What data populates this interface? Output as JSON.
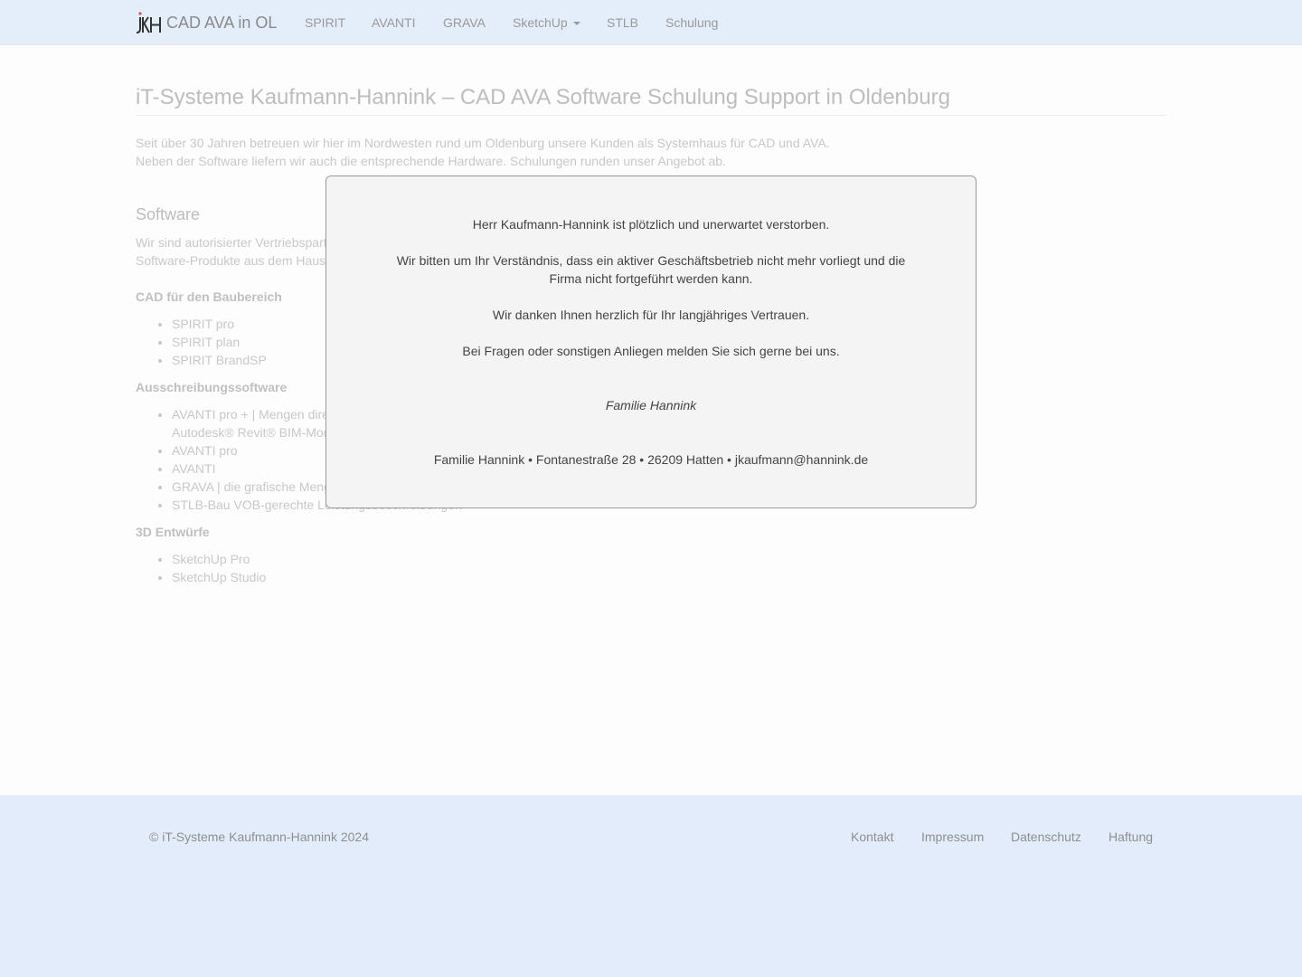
{
  "navbar": {
    "brand_text": "CAD AVA in OL",
    "items": [
      {
        "label": "SPIRIT"
      },
      {
        "label": "AVANTI"
      },
      {
        "label": "GRAVA"
      },
      {
        "label": "SketchUp"
      },
      {
        "label": "STLB"
      },
      {
        "label": "Schulung"
      }
    ]
  },
  "main": {
    "title": "iT-Systeme Kaufmann-Hannink – CAD AVA Software Schulung Support in Oldenburg",
    "intro_line1": "Seit über 30 Jahren betreuen wir hier im Nordwesten rund um Oldenburg unsere Kunden als Systemhaus für CAD und AVA.",
    "intro_line2": "Neben der Software liefern wir auch die entsprechende Hardware. Schulungen runden unser Angebot ab.",
    "software_heading": "Software",
    "software_line1": "Wir sind autorisierter Vertriebspartner",
    "software_line2": "Software-Produkte aus dem Haus",
    "categories": [
      {
        "title": "CAD für den Baubereich",
        "items": [
          "SPIRIT pro",
          "SPIRIT plan",
          "SPIRIT BrandSP"
        ]
      },
      {
        "title": "Ausschreibungssoftware",
        "items": [
          "AVANTI pro + | Mengen dire",
          "Autodesk® Revit® BIM-Mod",
          "AVANTI pro",
          "AVANTI",
          "GRAVA | die grafische Meng",
          "STLB-Bau VOB-gerechte Leistungsbeschreibungen"
        ]
      },
      {
        "title": "3D Entwürfe",
        "items": [
          "SketchUp Pro",
          "SketchUp Studio"
        ]
      }
    ]
  },
  "modal": {
    "line1": "Herr Kaufmann-Hannink ist plötzlich und unerwartet verstorben.",
    "line2a": "Wir bitten um Ihr Verständnis, dass ein aktiver Geschäftsbetrieb nicht mehr vorliegt und die",
    "line2b": "Firma nicht fortgeführt werden kann.",
    "line3": "Wir danken Ihnen herzlich für Ihr langjähriges Vertrauen.",
    "line4": "Bei Fragen oder sonstigen Anliegen melden Sie sich gerne bei uns.",
    "signature": "Familie Hannink",
    "contact": "Familie Hannink • Fontanestraße 28 • 26209 Hatten • jkaufmann@hannink.de"
  },
  "footer": {
    "copyright": "© iT-Systeme Kaufmann-Hannink 2024",
    "links": [
      "Kontakt",
      "Impressum",
      "Datenschutz",
      "Haftung"
    ]
  }
}
